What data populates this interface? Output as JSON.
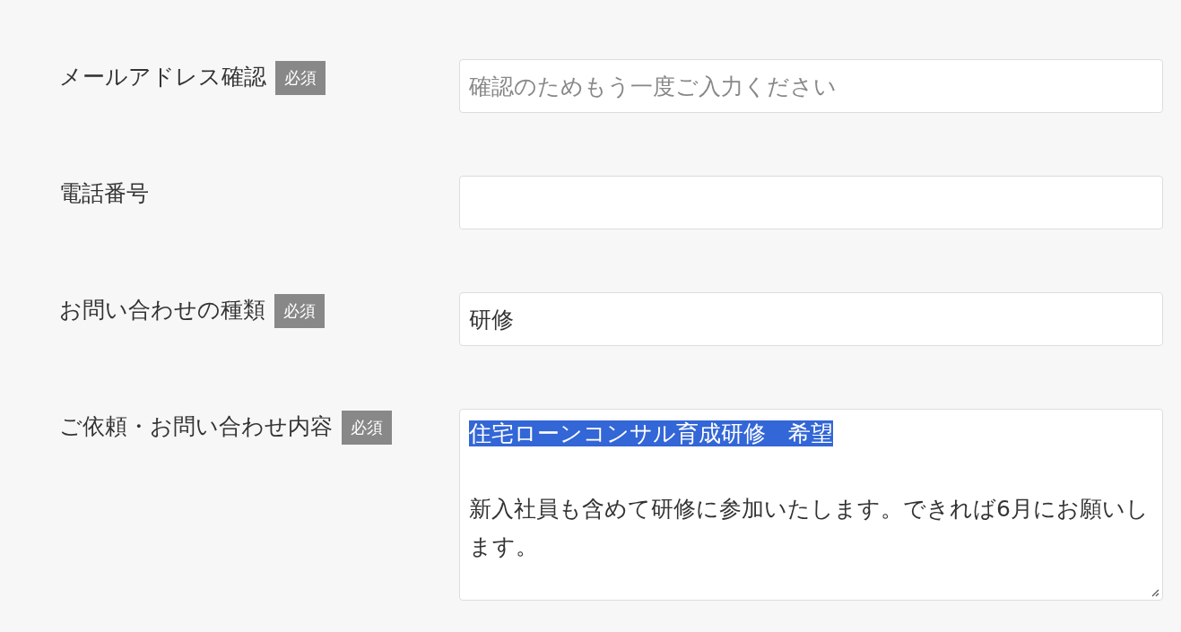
{
  "fields": [
    {
      "kind": "input",
      "label": "メールアドレス確認",
      "badge": "必須",
      "placeholder": "確認のためもう一度ご入力ください"
    },
    {
      "kind": "input",
      "label": "電話番号"
    },
    {
      "kind": "input",
      "label": "お問い合わせの種類",
      "badge": "必須",
      "value": "研修"
    },
    {
      "kind": "textarea",
      "label": "ご依頼・お問い合わせ内容",
      "badge": "必須",
      "paragraphs": [
        {
          "text": "住宅ローンコンサル育成研修　希望",
          "selected": true
        },
        {
          "text": "新入社員も含めて研修に参加いたします。できれば6月にお願いします。",
          "selected": false
        }
      ]
    }
  ]
}
